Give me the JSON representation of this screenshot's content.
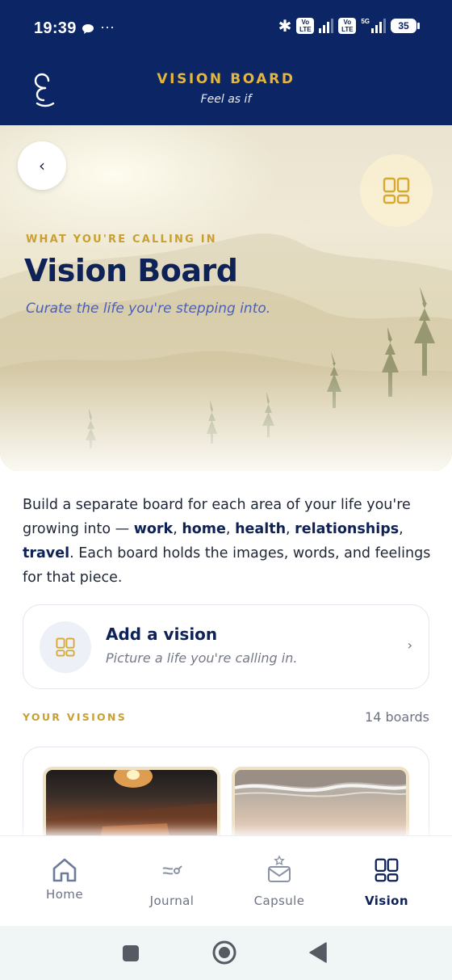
{
  "status_bar": {
    "time": "19:39",
    "dots": "···",
    "volte_label": "Vo\nLTE",
    "five_g": "5G",
    "battery": "35"
  },
  "header": {
    "title": "VISION BOARD",
    "subtitle": "Feel as if"
  },
  "hero": {
    "back_glyph": "‹",
    "eyebrow": "WHAT YOU'RE CALLING IN",
    "title": "Vision Board",
    "tagline": "Curate the life you're stepping into."
  },
  "intro": {
    "text_1": "Build a separate board for each area of your life you're growing into — ",
    "work": "work",
    "sep_1": ", ",
    "home": "home",
    "sep_2": ", ",
    "health": "health",
    "sep_3": ", ",
    "relationships": "relationships",
    "sep_4": ", ",
    "travel": "travel",
    "text_2": ". Each board holds the images, words, and feelings for that piece."
  },
  "add_vision": {
    "title": "Add a vision",
    "subtitle": "Picture a life you're calling in.",
    "chevron": "›"
  },
  "visions": {
    "label": "YOUR VISIONS",
    "count": "14 boards"
  },
  "bottom_nav": {
    "items": [
      {
        "label": "Home",
        "icon": "home-icon"
      },
      {
        "label": "Journal",
        "icon": "journal-icon"
      },
      {
        "label": "Capsule",
        "icon": "capsule-icon"
      },
      {
        "label": "Vision",
        "icon": "vision-icon"
      }
    ],
    "active": "Vision"
  },
  "colors": {
    "navy": "#0b2565",
    "gold": "#e6b63a",
    "accent_gold": "#c9a030",
    "tagline_blue": "#4a5fb8"
  }
}
